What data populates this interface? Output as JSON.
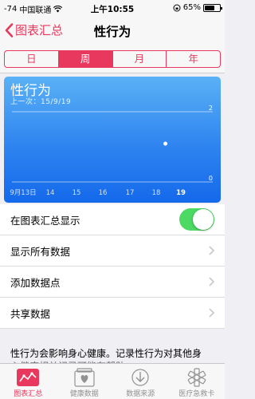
{
  "status": {
    "signal": "-74",
    "carrier": "中国联通",
    "time": "上午10:55",
    "battery": "65%",
    "battery_level": 0.65
  },
  "nav": {
    "back_label": "图表汇总",
    "title": "性行为"
  },
  "segments": [
    "日",
    "周",
    "月",
    "年"
  ],
  "chart_card": {
    "title": "性行为",
    "subtitle": "上一次：15/9/19"
  },
  "chart_data": {
    "type": "scatter",
    "categories": [
      "9月13日",
      "14",
      "15",
      "16",
      "17",
      "18",
      "19"
    ],
    "y_ticks": [
      "2",
      "0"
    ],
    "ylim": [
      0,
      2
    ],
    "points": [
      {
        "x": "18",
        "y": 1
      }
    ]
  },
  "list": {
    "show_in_summary": "在图表汇总显示",
    "show_all_data": "显示所有数据",
    "add_data_point": "添加数据点",
    "share_data": "共享数据"
  },
  "description": "性行为会影响身心健康。记录性行为对其他身",
  "description_cut": "心健康相关记录可能有帮助",
  "tabs": [
    "图表汇总",
    "健康数据",
    "数据来源",
    "医疗急救卡"
  ],
  "accent_color": "#e8385d"
}
